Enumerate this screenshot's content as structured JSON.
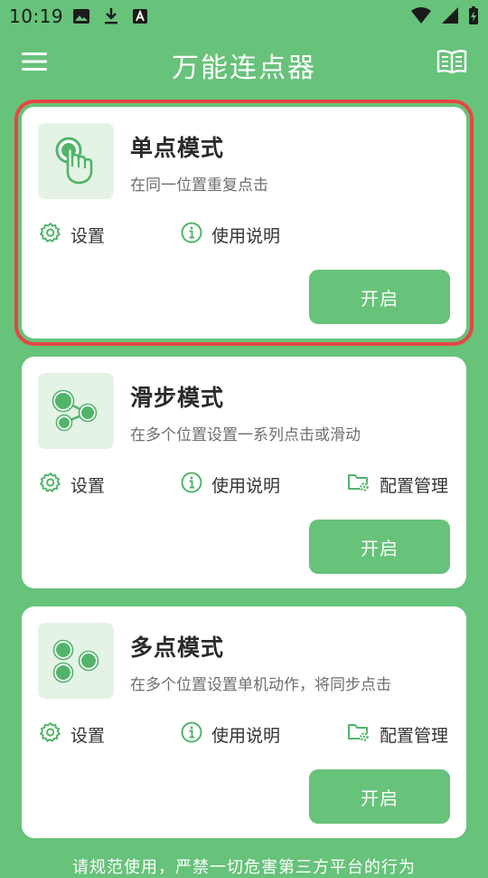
{
  "status_bar": {
    "time": "10:19",
    "icons_left": [
      "image-icon",
      "download-icon",
      "a-icon"
    ],
    "icons_right": [
      "wifi-icon",
      "signal-icon",
      "battery-charging-icon"
    ]
  },
  "header": {
    "title": "万能连点器",
    "menu_icon": "menu-icon",
    "right_icon": "book-icon"
  },
  "cards": [
    {
      "id": "single",
      "title": "单点模式",
      "description": "在同一位置重复点击",
      "settings_label": "设置",
      "help_label": "使用说明",
      "start_label": "开启",
      "icon": "tap-hand-icon",
      "highlighted": true
    },
    {
      "id": "slide",
      "title": "滑步模式",
      "description": "在多个位置设置一系列点击或滑动",
      "settings_label": "设置",
      "help_label": "使用说明",
      "config_label": "配置管理",
      "start_label": "开启",
      "icon": "connected-dots-icon"
    },
    {
      "id": "multi",
      "title": "多点模式",
      "description": "在多个位置设置单机动作，将同步点击",
      "settings_label": "设置",
      "help_label": "使用说明",
      "config_label": "配置管理",
      "start_label": "开启",
      "icon": "multi-dots-icon"
    }
  ],
  "footer": {
    "note": "请规范使用，严禁一切危害第三方平台的行为"
  },
  "colors": {
    "background": "#67c27a",
    "card": "#ffffff",
    "accent": "#67c27a",
    "icon_bg": "#e4f3e6",
    "highlight_border": "#e64545"
  }
}
